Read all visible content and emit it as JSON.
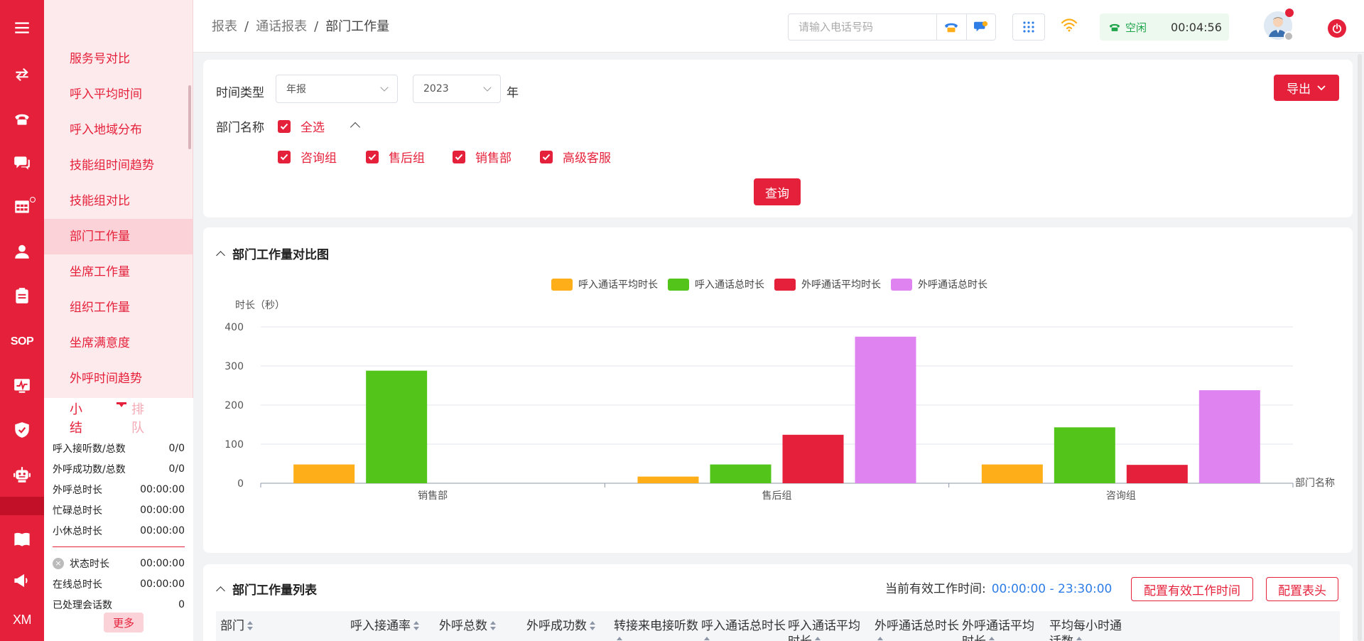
{
  "rail": {
    "items": [
      {
        "name": "menu-icon"
      },
      {
        "name": "transfer-icon"
      },
      {
        "name": "phone-icon"
      },
      {
        "name": "chat-icon"
      },
      {
        "name": "report-grid-icon"
      },
      {
        "name": "user-icon"
      },
      {
        "name": "clipboard-icon"
      },
      {
        "name": "sop-icon",
        "text": "SOP"
      },
      {
        "name": "monitor-icon"
      },
      {
        "name": "shield-icon"
      },
      {
        "name": "robot-icon"
      },
      {
        "name": "book-icon"
      },
      {
        "name": "megaphone-icon"
      },
      {
        "name": "xm-icon",
        "text": "XM"
      }
    ]
  },
  "submenu": {
    "items": [
      "服务号对比",
      "呼入平均时间",
      "呼入地域分布",
      "技能组时间趋势",
      "技能组对比",
      "部门工作量",
      "坐席工作量",
      "组织工作量",
      "坐席满意度",
      "外呼时间趋势"
    ],
    "active_index": 5
  },
  "summary": {
    "tabs": {
      "active": "小结",
      "inactive": "排队"
    },
    "rows": [
      {
        "label": "呼入接听数/总数",
        "value": "0/0"
      },
      {
        "label": "外呼成功数/总数",
        "value": "0/0"
      },
      {
        "label": "外呼总时长",
        "value": "00:00:00"
      },
      {
        "label": "忙碌总时长",
        "value": "00:00:00"
      },
      {
        "label": "小休总时长",
        "value": "00:00:00"
      }
    ],
    "rows2": [
      {
        "label": "状态时长",
        "value": "00:00:00"
      },
      {
        "label": "在线总时长",
        "value": "00:00:00"
      },
      {
        "label": "已处理会话数",
        "value": "0"
      }
    ],
    "more": "更多"
  },
  "header": {
    "breadcrumb": [
      "报表",
      "通话报表",
      "部门工作量"
    ],
    "phone_placeholder": "请输入电话号码",
    "status_label": "空闲",
    "status_time": "00:04:56"
  },
  "filter": {
    "time_type_label": "时间类型",
    "time_type_value": "年报",
    "year_value": "2023",
    "year_suffix": "年",
    "dept_label": "部门名称",
    "select_all": "全选",
    "departments": [
      "咨询组",
      "售后组",
      "销售部",
      "高级客服"
    ],
    "query": "查询",
    "export": "导出"
  },
  "chart_section": {
    "title": "部门工作量对比图"
  },
  "chart_data": {
    "type": "bar",
    "ylabel": "时长（秒）",
    "xlabel": "部门名称",
    "ylim": [
      0,
      400
    ],
    "yticks": [
      0,
      100,
      200,
      300,
      400
    ],
    "categories": [
      "销售部",
      "售后组",
      "咨询组"
    ],
    "legend_position": "top-center",
    "grid": true,
    "series": [
      {
        "name": "呼入通话平均时长",
        "color": "#fdae19",
        "values": [
          48,
          17,
          48
        ]
      },
      {
        "name": "呼入通话总时长",
        "color": "#52c41a",
        "values": [
          288,
          48,
          143
        ]
      },
      {
        "name": "外呼通话平均时长",
        "color": "#e5203a",
        "values": [
          0,
          124,
          47
        ]
      },
      {
        "name": "外呼通话总时长",
        "color": "#df83f0",
        "values": [
          0,
          375,
          238
        ]
      }
    ]
  },
  "table_section": {
    "title": "部门工作量列表",
    "effective_time_label": "当前有效工作时间:",
    "effective_time_value": "00:00:00 - 23:30:00",
    "config_time_btn": "配置有效工作时间",
    "config_header_btn": "配置表头",
    "columns": [
      "部门",
      "呼入接通率",
      "外呼总数",
      "外呼成功数",
      "转接来电接听数",
      "呼入通话总时长",
      "呼入通话平均时长",
      "外呼通话总时长",
      "外呼通话平均时长",
      "平均每小时通话数"
    ]
  }
}
